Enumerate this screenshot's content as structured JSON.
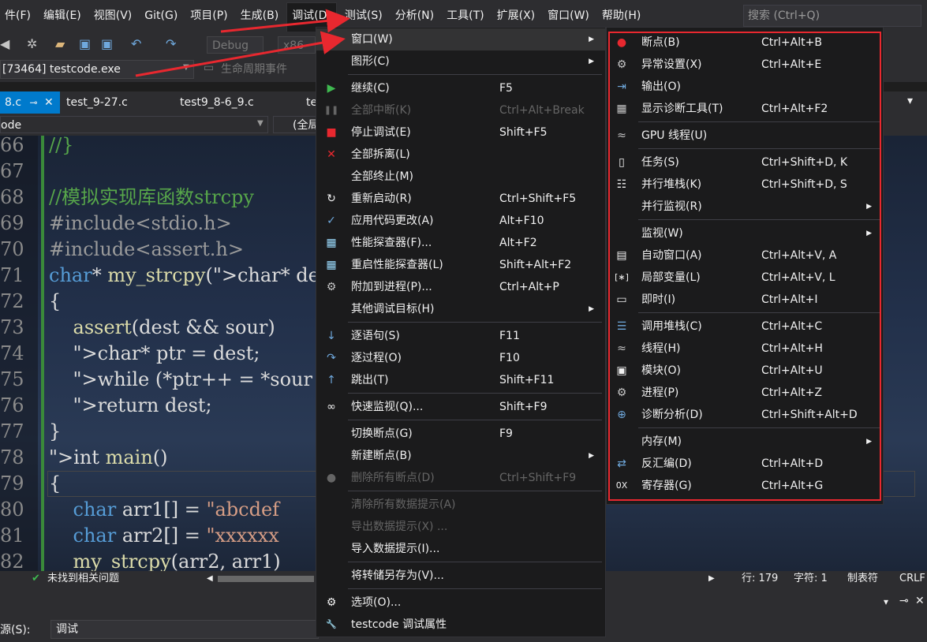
{
  "menubar": {
    "items": [
      "件(F)",
      "编辑(E)",
      "视图(V)",
      "Git(G)",
      "项目(P)",
      "生成(B)",
      "调试(D)",
      "测试(S)",
      "分析(N)",
      "工具(T)",
      "扩展(X)",
      "窗口(W)",
      "帮助(H)"
    ],
    "open_index": 6,
    "search_placeholder": "搜索 (Ctrl+Q)"
  },
  "toolbar": {
    "config": "Debug",
    "platform": "x86",
    "process": "[73464] testcode.exe",
    "lifecycle": "生命周期事件"
  },
  "tabs": [
    "8.c",
    "test_9-27.c",
    "test9_8-6_9.c",
    "te"
  ],
  "navbar": {
    "left": "ode",
    "scope": "(全局"
  },
  "code": {
    "lines": [
      {
        "n": "66",
        "text": "//}",
        "cls": "cm"
      },
      {
        "n": "67",
        "text": "",
        "cls": ""
      },
      {
        "n": "68",
        "text": "//模拟实现库函数strcpy",
        "cls": "cm"
      },
      {
        "n": "69",
        "text": "#include<stdio.h>",
        "cls": "pp"
      },
      {
        "n": "70",
        "text": "#include<assert.h>",
        "cls": "pp"
      },
      {
        "n": "71",
        "text": "char* my_strcpy(char* des",
        "cls": "mix1"
      },
      {
        "n": "72",
        "text": "{",
        "cls": ""
      },
      {
        "n": "73",
        "text": "    assert(dest && sour)",
        "cls": ""
      },
      {
        "n": "74",
        "text": "    char* ptr = dest;",
        "cls": "mix2"
      },
      {
        "n": "75",
        "text": "    while (*ptr++ = *sour",
        "cls": "mix3"
      },
      {
        "n": "76",
        "text": "    return dest;",
        "cls": "mix4"
      },
      {
        "n": "77",
        "text": "}",
        "cls": ""
      },
      {
        "n": "78",
        "text": "int main()",
        "cls": "mix5"
      },
      {
        "n": "79",
        "text": "{",
        "cls": ""
      },
      {
        "n": "80",
        "text": "    char arr1[] = \"abcdef",
        "cls": "mix6"
      },
      {
        "n": "81",
        "text": "    char arr2[] = \"xxxxxx",
        "cls": "mix6"
      },
      {
        "n": "82",
        "text": "    my_strcpy(arr2, arr1)",
        "cls": ""
      }
    ]
  },
  "status": {
    "issues": "未找到相关问题",
    "line": "行: 179",
    "char": "字符: 1",
    "tabs": "制表符",
    "eol": "CRLF"
  },
  "output": {
    "source_label": "源(S):",
    "source_value": "调试"
  },
  "debug_menu": {
    "items": [
      {
        "label": "窗口(W)",
        "shortcut": "",
        "submenu": true,
        "icon": "",
        "disabled": false,
        "highlight": true
      },
      {
        "label": "图形(C)",
        "shortcut": "",
        "submenu": true,
        "icon": "",
        "disabled": false
      },
      {
        "sep": true
      },
      {
        "label": "继续(C)",
        "shortcut": "F5",
        "icon": "play-icon",
        "disabled": false
      },
      {
        "label": "全部中断(K)",
        "shortcut": "Ctrl+Alt+Break",
        "icon": "pause-icon",
        "disabled": true
      },
      {
        "label": "停止调试(E)",
        "shortcut": "Shift+F5",
        "icon": "stop-icon",
        "disabled": false
      },
      {
        "label": "全部拆离(L)",
        "shortcut": "",
        "icon": "x-icon",
        "disabled": false
      },
      {
        "label": "全部终止(M)",
        "shortcut": "",
        "icon": "",
        "disabled": false
      },
      {
        "label": "重新启动(R)",
        "shortcut": "Ctrl+Shift+F5",
        "icon": "restart-icon",
        "disabled": false
      },
      {
        "label": "应用代码更改(A)",
        "shortcut": "Alt+F10",
        "icon": "apply-changes-icon",
        "disabled": false
      },
      {
        "label": "性能探查器(F)...",
        "shortcut": "Alt+F2",
        "icon": "profiler-icon",
        "disabled": false
      },
      {
        "label": "重启性能探查器(L)",
        "shortcut": "Shift+Alt+F2",
        "icon": "profiler-restart-icon",
        "disabled": false
      },
      {
        "label": "附加到进程(P)...",
        "shortcut": "Ctrl+Alt+P",
        "icon": "attach-icon",
        "disabled": false
      },
      {
        "label": "其他调试目标(H)",
        "shortcut": "",
        "submenu": true,
        "icon": "",
        "disabled": false
      },
      {
        "sep": true
      },
      {
        "label": "逐语句(S)",
        "shortcut": "F11",
        "icon": "step-into-icon",
        "disabled": false
      },
      {
        "label": "逐过程(O)",
        "shortcut": "F10",
        "icon": "step-over-icon",
        "disabled": false
      },
      {
        "label": "跳出(T)",
        "shortcut": "Shift+F11",
        "icon": "step-out-icon",
        "disabled": false
      },
      {
        "sep": true
      },
      {
        "label": "快速监视(Q)...",
        "shortcut": "Shift+F9",
        "icon": "glasses-icon",
        "disabled": false
      },
      {
        "sep": true
      },
      {
        "label": "切换断点(G)",
        "shortcut": "F9",
        "icon": "",
        "disabled": false
      },
      {
        "label": "新建断点(B)",
        "shortcut": "",
        "submenu": true,
        "icon": "",
        "disabled": false
      },
      {
        "label": "删除所有断点(D)",
        "shortcut": "Ctrl+Shift+F9",
        "icon": "delete-breakpoints-icon",
        "disabled": true
      },
      {
        "sep": true
      },
      {
        "label": "清除所有数据提示(A)",
        "shortcut": "",
        "icon": "",
        "disabled": true
      },
      {
        "label": "导出数据提示(X) ...",
        "shortcut": "",
        "icon": "",
        "disabled": true
      },
      {
        "label": "导入数据提示(I)...",
        "shortcut": "",
        "icon": "",
        "disabled": false
      },
      {
        "sep": true
      },
      {
        "label": "将转储另存为(V)...",
        "shortcut": "",
        "icon": "",
        "disabled": false
      },
      {
        "sep": true
      },
      {
        "label": "选项(O)...",
        "shortcut": "",
        "icon": "gear-icon",
        "disabled": false
      },
      {
        "label": "testcode 调试属性",
        "shortcut": "",
        "icon": "wrench-icon",
        "disabled": false
      }
    ]
  },
  "window_submenu": {
    "items": [
      {
        "label": "断点(B)",
        "shortcut": "Ctrl+Alt+B",
        "icon": "breakpoint-icon"
      },
      {
        "label": "异常设置(X)",
        "shortcut": "Ctrl+Alt+E",
        "icon": "exception-settings-icon"
      },
      {
        "label": "输出(O)",
        "shortcut": "",
        "icon": "output-icon"
      },
      {
        "label": "显示诊断工具(T)",
        "shortcut": "Ctrl+Alt+F2",
        "icon": "diagnostic-tools-icon"
      },
      {
        "sep": true
      },
      {
        "label": "GPU 线程(U)",
        "shortcut": "",
        "icon": "gpu-threads-icon"
      },
      {
        "sep": true
      },
      {
        "label": "任务(S)",
        "shortcut": "Ctrl+Shift+D, K",
        "icon": "tasks-icon"
      },
      {
        "label": "并行堆栈(K)",
        "shortcut": "Ctrl+Shift+D, S",
        "icon": "parallel-stacks-icon"
      },
      {
        "label": "并行监视(R)",
        "shortcut": "",
        "submenu": true,
        "icon": ""
      },
      {
        "sep": true
      },
      {
        "label": "监视(W)",
        "shortcut": "",
        "submenu": true,
        "icon": ""
      },
      {
        "label": "自动窗口(A)",
        "shortcut": "Ctrl+Alt+V, A",
        "icon": "autos-icon"
      },
      {
        "label": "局部变量(L)",
        "shortcut": "Ctrl+Alt+V, L",
        "icon": "locals-icon"
      },
      {
        "label": "即时(I)",
        "shortcut": "Ctrl+Alt+I",
        "icon": "immediate-icon"
      },
      {
        "sep": true
      },
      {
        "label": "调用堆栈(C)",
        "shortcut": "Ctrl+Alt+C",
        "icon": "call-stack-icon"
      },
      {
        "label": "线程(H)",
        "shortcut": "Ctrl+Alt+H",
        "icon": "threads-icon"
      },
      {
        "label": "模块(O)",
        "shortcut": "Ctrl+Alt+U",
        "icon": "modules-icon"
      },
      {
        "label": "进程(P)",
        "shortcut": "Ctrl+Alt+Z",
        "icon": "processes-icon"
      },
      {
        "label": "诊断分析(D)",
        "shortcut": "Ctrl+Shift+Alt+D",
        "icon": "diagnostic-analysis-icon"
      },
      {
        "sep": true
      },
      {
        "label": "内存(M)",
        "shortcut": "",
        "submenu": true,
        "icon": ""
      },
      {
        "label": "反汇编(D)",
        "shortcut": "Ctrl+Alt+D",
        "icon": "disassembly-icon"
      },
      {
        "label": "寄存器(G)",
        "shortcut": "Ctrl+Alt+G",
        "icon": "registers-icon"
      }
    ]
  },
  "colors": {
    "accent": "#007acc",
    "annotation_red": "#e8282f",
    "menu_bg": "#1b1b1c"
  }
}
